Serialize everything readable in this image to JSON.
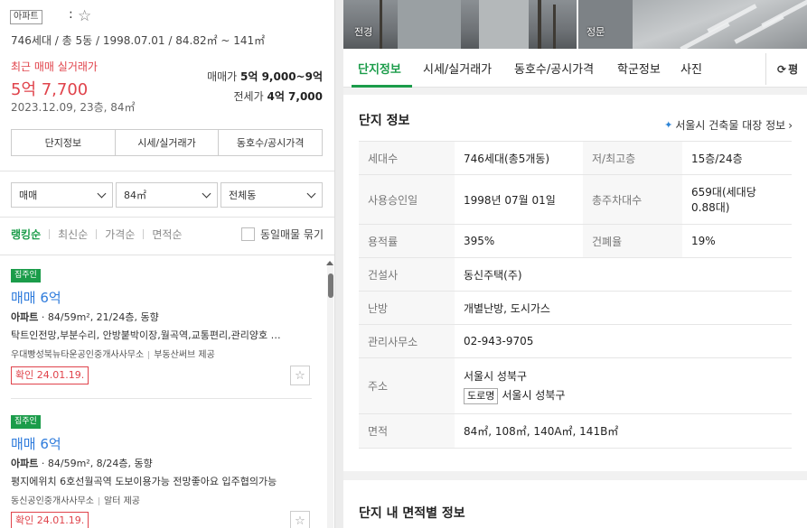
{
  "left": {
    "type_tag": "아파트",
    "title_colon": ":",
    "summary": "746세대 / 총 5동 / 1998.07.01 / 84.82㎡ ~ 141㎡",
    "recent_label": "최근 매매 실거래가",
    "recent_price": "5억 7,700",
    "recent_date": "2023.12.09, 23층, 84㎡",
    "sale_range_label": "매매가",
    "sale_range_value": "5억 9,000~9억",
    "lease_label": "전세가",
    "lease_value": "4억 7,000",
    "buttons": [
      "단지정보",
      "시세/실거래가",
      "동호수/공시가격"
    ],
    "filters": [
      "매매",
      "84㎡",
      "전체동"
    ],
    "sorts": [
      "랭킹순",
      "최신순",
      "가격순",
      "면적순"
    ],
    "group_label": "동일매물 묶기",
    "listings": [
      {
        "badge": "집주인",
        "title": "매매 6억",
        "type": "아파트",
        "meta": "· 84/59m², 21/24층, 동향",
        "desc": "탁트인전망,부분수리, 안방붙박이장,월곡역,교통편리,관리양호 …",
        "agent": "우대빵성북뉴타운공인중개사사무소",
        "provider": "부동산써브 제공",
        "confirm": "확인 24.01.19."
      },
      {
        "badge": "집주인",
        "title": "매매 6억",
        "type": "아파트",
        "meta": "· 84/59m², 8/24층, 동향",
        "desc": "평지에위치 6호선월곡역 도보이용가능 전망좋아요 입주협의가능",
        "agent": "동신공인중개사사무소",
        "provider": "알터 제공",
        "confirm": "확인 24.01.19."
      }
    ]
  },
  "right": {
    "photos": [
      {
        "label": "전경"
      },
      {
        "label": "정문"
      }
    ],
    "tabs": [
      "단지정보",
      "시세/실거래가",
      "동호수/공시가격",
      "학군정보",
      "사진"
    ],
    "tab_more": "평",
    "info_title": "단지 정보",
    "seoul_link": "서울시 건축물 대장 정보",
    "rows": [
      {
        "l1": "세대수",
        "v1": "746세대(총5개동)",
        "l2": "저/최고층",
        "v2": "15층/24층"
      },
      {
        "l1": "사용승인일",
        "v1": "1998년 07월 01일",
        "l2": "총주차대수",
        "v2": "659대(세대당 0.88대)"
      },
      {
        "l1": "용적률",
        "v1": "395%",
        "l2": "건폐율",
        "v2": "19%"
      }
    ],
    "builder_label": "건설사",
    "builder": "동신주택(주)",
    "heating_label": "난방",
    "heating": "개별난방, 도시가스",
    "office_label": "관리사무소",
    "office": "02-943-9705",
    "address_label": "주소",
    "address": "서울시 성북구",
    "road_tag": "도로명",
    "road_address": "서울시 성북구",
    "area_label": "면적",
    "area": "84㎡, 108㎡, 140A㎡, 141B㎡",
    "area_title": "단지 내 면적별 정보"
  }
}
